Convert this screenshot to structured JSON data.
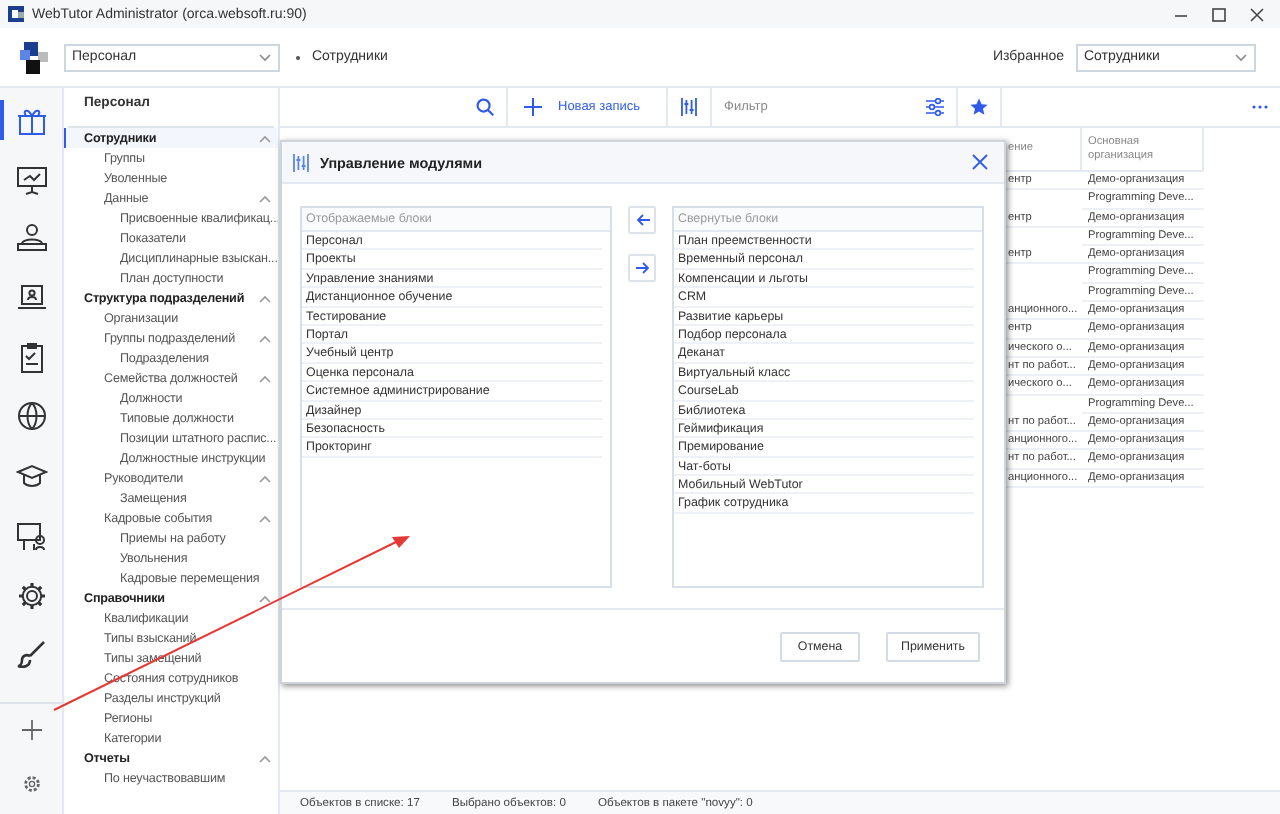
{
  "window": {
    "title": "WebTutor Administrator (orca.websoft.ru:90)"
  },
  "header": {
    "module_select": {
      "value": "Персонал"
    },
    "breadcrumb": "Сотрудники",
    "favorites_label": "Избранное",
    "favorites_select": {
      "value": "Сотрудники"
    }
  },
  "rail_items": [
    {
      "selected": true
    },
    {
      "selected": false
    },
    {
      "selected": false
    },
    {
      "selected": false
    },
    {
      "selected": false
    },
    {
      "selected": false
    },
    {
      "selected": false
    },
    {
      "selected": false
    },
    {
      "selected": false
    },
    {
      "selected": false
    }
  ],
  "sidebar": {
    "title": "Персонал",
    "items": [
      {
        "label": "Сотрудники",
        "selected": true,
        "expanded": true,
        "children": [
          {
            "label": "Группы",
            "selected": false
          },
          {
            "label": "Уволенные",
            "selected": false
          },
          {
            "label": "Данные",
            "selected": false,
            "expanded": true,
            "children": [
              {
                "label": "Присвоенные квалификац...",
                "selected": false
              },
              {
                "label": "Показатели",
                "selected": false
              },
              {
                "label": "Дисциплинарные взыскан...",
                "selected": false
              },
              {
                "label": "План доступности",
                "selected": false
              }
            ]
          }
        ]
      },
      {
        "label": "Структура подразделений",
        "selected": false,
        "expanded": true,
        "children": [
          {
            "label": "Организации",
            "selected": false
          },
          {
            "label": "Группы подразделений",
            "selected": false,
            "expanded": true,
            "children": [
              {
                "label": "Подразделения",
                "selected": false
              }
            ]
          },
          {
            "label": "Семейства должностей",
            "selected": false,
            "expanded": true,
            "children": [
              {
                "label": "Должности",
                "selected": false
              },
              {
                "label": "Типовые должности",
                "selected": false
              },
              {
                "label": "Позиции штатного распис...",
                "selected": false
              },
              {
                "label": "Должностные инструкции",
                "selected": false
              }
            ]
          },
          {
            "label": "Руководители",
            "selected": false,
            "expanded": true,
            "children": [
              {
                "label": "Замещения",
                "selected": false
              }
            ]
          },
          {
            "label": "Кадровые события",
            "selected": false,
            "expanded": true,
            "children": [
              {
                "label": "Приемы на работу",
                "selected": false
              },
              {
                "label": "Увольнения",
                "selected": false
              },
              {
                "label": "Кадровые перемещения",
                "selected": false
              }
            ]
          }
        ]
      },
      {
        "label": "Справочники",
        "selected": false,
        "expanded": true,
        "children": [
          {
            "label": "Квалификации",
            "selected": false
          },
          {
            "label": "Типы взысканий",
            "selected": false
          },
          {
            "label": "Типы замещений",
            "selected": false
          },
          {
            "label": "Состояния сотрудников",
            "selected": false
          },
          {
            "label": "Разделы инструкций",
            "selected": false
          },
          {
            "label": "Регионы",
            "selected": false
          },
          {
            "label": "Категории",
            "selected": false
          }
        ]
      },
      {
        "label": "Отчеты",
        "selected": false,
        "expanded": true,
        "children": [
          {
            "label": "По неучаствовавшим",
            "selected": false
          }
        ]
      }
    ]
  },
  "toolbar": {
    "new_record": "Новая запись",
    "filter": {
      "placeholder": "Фильтр"
    }
  },
  "table": {
    "columns": [
      "ение",
      "Основная организация"
    ],
    "rows": [
      {
        "column_1": "ентр",
        "column_2": "Демо-организация"
      },
      {
        "column_2": "Programming Deve..."
      },
      {
        "column_1": "ентр",
        "column_2": "Демо-организация"
      },
      {
        "column_2": "Programming Deve..."
      },
      {
        "column_1": "ентр",
        "column_2": "Демо-организация"
      },
      {
        "column_2": "Programming Deve..."
      },
      {
        "column_2": "Programming Deve..."
      },
      {
        "column_1": "анционного...",
        "column_2": "Демо-организация"
      },
      {
        "column_1": "ентр",
        "column_2": "Демо-организация"
      },
      {
        "column_1": "ического о...",
        "column_2": "Демо-организация"
      },
      {
        "column_1": "нт по работ...",
        "column_2": "Демо-организация"
      },
      {
        "column_1": "ического о...",
        "column_2": "Демо-организация"
      },
      {
        "column_2": "Programming Deve..."
      },
      {
        "column_1": "нт по работ...",
        "column_2": "Демо-организация"
      },
      {
        "column_1": "анционного...",
        "column_2": "Демо-организация"
      },
      {
        "column_1": "нт по работ...",
        "column_2": "Демо-организация"
      },
      {
        "column_1": "анционного...",
        "column_2": "Демо-организация"
      }
    ]
  },
  "dialog": {
    "title": "Управление модулями",
    "shown_blocks": {
      "header": "Отображаемые блоки",
      "items": [
        "Персонал",
        "Проекты",
        "Управление знаниями",
        "Дистанционное обучение",
        "Тестирование",
        "Портал",
        "Учебный центр",
        "Оценка персонала",
        "Системное администрирование",
        "Дизайнер",
        "Безопасность",
        "Прокторинг"
      ]
    },
    "hidden_blocks": {
      "header": "Свернутые блоки",
      "items": [
        "План преемственности",
        "Временный персонал",
        "Компенсации и льготы",
        "CRM",
        "Развитие карьеры",
        "Подбор персонала",
        "Деканат",
        "Виртуальный класс",
        "CourseLab",
        "Библиотека",
        "Геймификация",
        "Премирование",
        "Чат-боты",
        "Мобильный WebTutor",
        "График сотрудника"
      ]
    },
    "buttons": [
      "Отмена",
      "Применить"
    ]
  },
  "status_bar": [
    "Объектов в списке: 17",
    "Выбрано объектов: 0",
    "Объектов в пакете \"novyy\": 0"
  ]
}
